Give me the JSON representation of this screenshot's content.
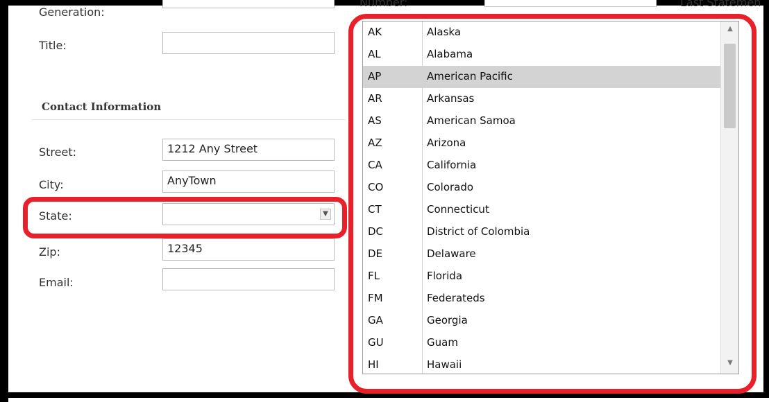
{
  "form": {
    "generation_label": "Generation:",
    "title_label": "Title:",
    "section_title": "Contact Information",
    "street_label": "Street:",
    "street_value": "1212 Any Street",
    "city_label": "City:",
    "city_value": "AnyTown",
    "state_label": "State:",
    "state_value": "",
    "zip_label": "Zip:",
    "zip_value": "12345",
    "email_label": "Email:",
    "email_value": ""
  },
  "background": {
    "right_label_1": "Number:",
    "right_label_2": "Last Statemen"
  },
  "dropdown": {
    "selected_index": 2,
    "items": [
      {
        "code": "AK",
        "name": "Alaska"
      },
      {
        "code": "AL",
        "name": "Alabama"
      },
      {
        "code": "AP",
        "name": "American Pacific"
      },
      {
        "code": "AR",
        "name": "Arkansas"
      },
      {
        "code": "AS",
        "name": "American Samoa"
      },
      {
        "code": "AZ",
        "name": "Arizona"
      },
      {
        "code": "CA",
        "name": "California"
      },
      {
        "code": "CO",
        "name": "Colorado"
      },
      {
        "code": "CT",
        "name": "Connecticut"
      },
      {
        "code": "DC",
        "name": "District of Colombia"
      },
      {
        "code": "DE",
        "name": "Delaware"
      },
      {
        "code": "FL",
        "name": "Florida"
      },
      {
        "code": "FM",
        "name": "Federateds"
      },
      {
        "code": "GA",
        "name": "Georgia"
      },
      {
        "code": "GU",
        "name": "Guam"
      },
      {
        "code": "HI",
        "name": "Hawaii"
      }
    ]
  },
  "icons": {
    "select_arrow": "chevron-down-icon",
    "scroll_up": "scroll-up-icon",
    "scroll_down": "scroll-down-icon"
  },
  "colors": {
    "annotation_red": "#e8202a",
    "selected_row": "#d3d3d3"
  }
}
